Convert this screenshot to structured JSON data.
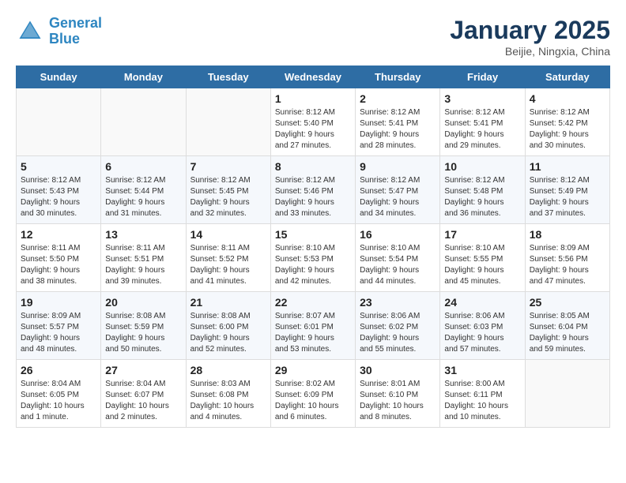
{
  "header": {
    "logo_line1": "General",
    "logo_line2": "Blue",
    "title": "January 2025",
    "subtitle": "Beijie, Ningxia, China"
  },
  "days_of_week": [
    "Sunday",
    "Monday",
    "Tuesday",
    "Wednesday",
    "Thursday",
    "Friday",
    "Saturday"
  ],
  "weeks": [
    [
      {
        "day": "",
        "info": ""
      },
      {
        "day": "",
        "info": ""
      },
      {
        "day": "",
        "info": ""
      },
      {
        "day": "1",
        "info": "Sunrise: 8:12 AM\nSunset: 5:40 PM\nDaylight: 9 hours\nand 27 minutes."
      },
      {
        "day": "2",
        "info": "Sunrise: 8:12 AM\nSunset: 5:41 PM\nDaylight: 9 hours\nand 28 minutes."
      },
      {
        "day": "3",
        "info": "Sunrise: 8:12 AM\nSunset: 5:41 PM\nDaylight: 9 hours\nand 29 minutes."
      },
      {
        "day": "4",
        "info": "Sunrise: 8:12 AM\nSunset: 5:42 PM\nDaylight: 9 hours\nand 30 minutes."
      }
    ],
    [
      {
        "day": "5",
        "info": "Sunrise: 8:12 AM\nSunset: 5:43 PM\nDaylight: 9 hours\nand 30 minutes."
      },
      {
        "day": "6",
        "info": "Sunrise: 8:12 AM\nSunset: 5:44 PM\nDaylight: 9 hours\nand 31 minutes."
      },
      {
        "day": "7",
        "info": "Sunrise: 8:12 AM\nSunset: 5:45 PM\nDaylight: 9 hours\nand 32 minutes."
      },
      {
        "day": "8",
        "info": "Sunrise: 8:12 AM\nSunset: 5:46 PM\nDaylight: 9 hours\nand 33 minutes."
      },
      {
        "day": "9",
        "info": "Sunrise: 8:12 AM\nSunset: 5:47 PM\nDaylight: 9 hours\nand 34 minutes."
      },
      {
        "day": "10",
        "info": "Sunrise: 8:12 AM\nSunset: 5:48 PM\nDaylight: 9 hours\nand 36 minutes."
      },
      {
        "day": "11",
        "info": "Sunrise: 8:12 AM\nSunset: 5:49 PM\nDaylight: 9 hours\nand 37 minutes."
      }
    ],
    [
      {
        "day": "12",
        "info": "Sunrise: 8:11 AM\nSunset: 5:50 PM\nDaylight: 9 hours\nand 38 minutes."
      },
      {
        "day": "13",
        "info": "Sunrise: 8:11 AM\nSunset: 5:51 PM\nDaylight: 9 hours\nand 39 minutes."
      },
      {
        "day": "14",
        "info": "Sunrise: 8:11 AM\nSunset: 5:52 PM\nDaylight: 9 hours\nand 41 minutes."
      },
      {
        "day": "15",
        "info": "Sunrise: 8:10 AM\nSunset: 5:53 PM\nDaylight: 9 hours\nand 42 minutes."
      },
      {
        "day": "16",
        "info": "Sunrise: 8:10 AM\nSunset: 5:54 PM\nDaylight: 9 hours\nand 44 minutes."
      },
      {
        "day": "17",
        "info": "Sunrise: 8:10 AM\nSunset: 5:55 PM\nDaylight: 9 hours\nand 45 minutes."
      },
      {
        "day": "18",
        "info": "Sunrise: 8:09 AM\nSunset: 5:56 PM\nDaylight: 9 hours\nand 47 minutes."
      }
    ],
    [
      {
        "day": "19",
        "info": "Sunrise: 8:09 AM\nSunset: 5:57 PM\nDaylight: 9 hours\nand 48 minutes."
      },
      {
        "day": "20",
        "info": "Sunrise: 8:08 AM\nSunset: 5:59 PM\nDaylight: 9 hours\nand 50 minutes."
      },
      {
        "day": "21",
        "info": "Sunrise: 8:08 AM\nSunset: 6:00 PM\nDaylight: 9 hours\nand 52 minutes."
      },
      {
        "day": "22",
        "info": "Sunrise: 8:07 AM\nSunset: 6:01 PM\nDaylight: 9 hours\nand 53 minutes."
      },
      {
        "day": "23",
        "info": "Sunrise: 8:06 AM\nSunset: 6:02 PM\nDaylight: 9 hours\nand 55 minutes."
      },
      {
        "day": "24",
        "info": "Sunrise: 8:06 AM\nSunset: 6:03 PM\nDaylight: 9 hours\nand 57 minutes."
      },
      {
        "day": "25",
        "info": "Sunrise: 8:05 AM\nSunset: 6:04 PM\nDaylight: 9 hours\nand 59 minutes."
      }
    ],
    [
      {
        "day": "26",
        "info": "Sunrise: 8:04 AM\nSunset: 6:05 PM\nDaylight: 10 hours\nand 1 minute."
      },
      {
        "day": "27",
        "info": "Sunrise: 8:04 AM\nSunset: 6:07 PM\nDaylight: 10 hours\nand 2 minutes."
      },
      {
        "day": "28",
        "info": "Sunrise: 8:03 AM\nSunset: 6:08 PM\nDaylight: 10 hours\nand 4 minutes."
      },
      {
        "day": "29",
        "info": "Sunrise: 8:02 AM\nSunset: 6:09 PM\nDaylight: 10 hours\nand 6 minutes."
      },
      {
        "day": "30",
        "info": "Sunrise: 8:01 AM\nSunset: 6:10 PM\nDaylight: 10 hours\nand 8 minutes."
      },
      {
        "day": "31",
        "info": "Sunrise: 8:00 AM\nSunset: 6:11 PM\nDaylight: 10 hours\nand 10 minutes."
      },
      {
        "day": "",
        "info": ""
      }
    ]
  ]
}
